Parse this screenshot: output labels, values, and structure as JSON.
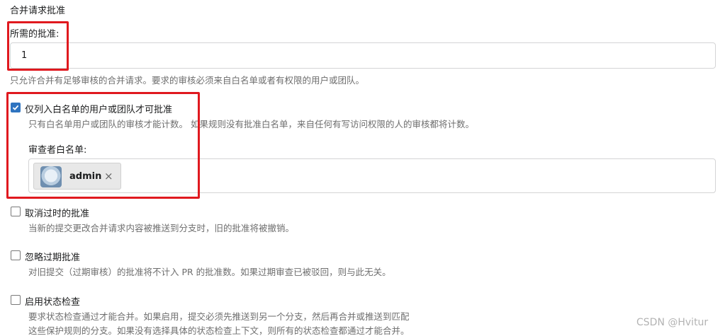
{
  "section_title": "合并请求批准",
  "required_approvals": {
    "label": "所需的批准:",
    "value": "1",
    "help": "只允许合并有足够审核的合并请求。要求的审核必须来自白名单或者有权限的用户或团队。"
  },
  "whitelist_option": {
    "checked": true,
    "label": "仅列入白名单的用户或团队才可批准",
    "help": "只有白名单用户或团队的审核才能计数。 如果规则没有批准白名单，来自任何有写访问权限的人的审核都将计数。",
    "reviewer_label": "审查者白名单:",
    "reviewers": [
      {
        "name": "admin"
      }
    ],
    "remove_glyph": "×"
  },
  "dismiss_stale": {
    "checked": false,
    "label": "取消过时的批准",
    "help": "当新的提交更改合并请求内容被推送到分支时，旧的批准将被撤销。"
  },
  "ignore_stale": {
    "checked": false,
    "label": "忽略过期批准",
    "help": "对旧提交（过期审核）的批准将不计入 PR 的批准数。如果过期审查已被驳回，则与此无关。"
  },
  "status_check": {
    "checked": false,
    "label": "启用状态检查",
    "help_line1": "要求状态检查通过才能合并。如果启用，提交必须先推送到另一个分支，然后再合并或推送到匹配",
    "help_line2": "这些保护规则的分支。如果没有选择具体的状态检查上下文，则所有的状态检查都通过才能合并。"
  },
  "watermark": "CSDN @Hvitur",
  "colors": {
    "accent": "#2f74c0",
    "highlight": "#e0191f"
  }
}
